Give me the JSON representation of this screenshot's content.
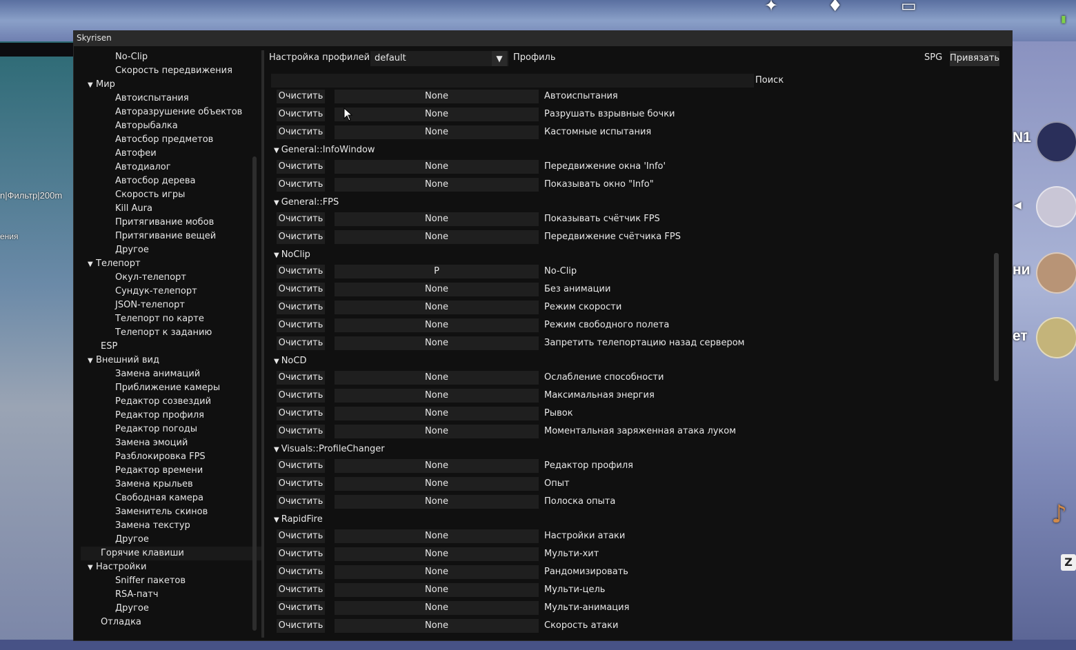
{
  "window": {
    "title": "Skyrisen"
  },
  "background": {
    "left_text_1": "n|Фильтр|200m",
    "left_text_2": "ения",
    "right_labels": [
      "N1",
      "ни",
      "ет"
    ],
    "right_key": "Z"
  },
  "sidebar": {
    "items": [
      {
        "label": "No-Clip",
        "level": 2
      },
      {
        "label": "Скорость передвижения",
        "level": 2
      },
      {
        "label": "Мир",
        "level": 1,
        "expanded": true
      },
      {
        "label": "Автоиспытания",
        "level": 2
      },
      {
        "label": "Авторазрушение объектов",
        "level": 2
      },
      {
        "label": "Авторыбалка",
        "level": 2
      },
      {
        "label": "Автосбор предметов",
        "level": 2
      },
      {
        "label": "Автофеи",
        "level": 2
      },
      {
        "label": "Автодиалог",
        "level": 2
      },
      {
        "label": "Автосбор дерева",
        "level": 2
      },
      {
        "label": "Скорость игры",
        "level": 2
      },
      {
        "label": "Kill Aura",
        "level": 2
      },
      {
        "label": "Притягивание мобов",
        "level": 2
      },
      {
        "label": "Притягивание вещей",
        "level": 2
      },
      {
        "label": "Другое",
        "level": 2
      },
      {
        "label": "Телепорт",
        "level": 1,
        "expanded": true
      },
      {
        "label": "Окул-телепорт",
        "level": 2
      },
      {
        "label": "Сундук-телепорт",
        "level": 2
      },
      {
        "label": "JSON-телепорт",
        "level": 2
      },
      {
        "label": "Телепорт по карте",
        "level": 2
      },
      {
        "label": "Телепорт к заданию",
        "level": 2
      },
      {
        "label": "ESP",
        "level": 1
      },
      {
        "label": "Внешний вид",
        "level": 1,
        "expanded": true
      },
      {
        "label": "Замена анимаций",
        "level": 2
      },
      {
        "label": "Приближение камеры",
        "level": 2
      },
      {
        "label": "Редактор созвездий",
        "level": 2
      },
      {
        "label": "Редактор профиля",
        "level": 2
      },
      {
        "label": "Редактор погоды",
        "level": 2
      },
      {
        "label": "Замена эмоций",
        "level": 2
      },
      {
        "label": "Разблокировка FPS",
        "level": 2
      },
      {
        "label": "Редактор времени",
        "level": 2
      },
      {
        "label": "Замена крыльев",
        "level": 2
      },
      {
        "label": "Свободная камера",
        "level": 2
      },
      {
        "label": "Заменитель скинов",
        "level": 2
      },
      {
        "label": "Замена текстур",
        "level": 2
      },
      {
        "label": "Другое",
        "level": 2
      },
      {
        "label": "Горячие клавиши",
        "level": 1,
        "selected": true
      },
      {
        "label": "Настройки",
        "level": 1,
        "expanded": true
      },
      {
        "label": "Sniffer пакетов",
        "level": 2
      },
      {
        "label": "RSA-патч",
        "level": 2
      },
      {
        "label": "Другое",
        "level": 2
      },
      {
        "label": "Отладка",
        "level": 1
      }
    ]
  },
  "topbar": {
    "profile_settings_label": "Настройка профилей",
    "profile_value": "default",
    "dropdown_arrow": "▼",
    "profile_label": "Профиль",
    "spg_label": "SPG",
    "bind_button": "Привязать"
  },
  "search": {
    "label": "Поиск",
    "value": ""
  },
  "hotkeys": {
    "clear_label": "Очистить",
    "entries": [
      {
        "type": "row",
        "key": "None",
        "name": "Автоиспытания"
      },
      {
        "type": "row",
        "key": "None",
        "name": "Разрушать взрывные бочки"
      },
      {
        "type": "row",
        "key": "None",
        "name": "Кастомные испытания"
      },
      {
        "type": "section",
        "title": "General::InfoWindow"
      },
      {
        "type": "row",
        "key": "None",
        "name": "Передвижение окна 'Info'"
      },
      {
        "type": "row",
        "key": "None",
        "name": "Показывать окно \"Info\""
      },
      {
        "type": "section",
        "title": "General::FPS"
      },
      {
        "type": "row",
        "key": "None",
        "name": "Показывать счётчик FPS"
      },
      {
        "type": "row",
        "key": "None",
        "name": "Передвижение счётчика FPS"
      },
      {
        "type": "section",
        "title": "NoClip"
      },
      {
        "type": "row",
        "key": "P",
        "name": "No-Clip"
      },
      {
        "type": "row",
        "key": "None",
        "name": "Без анимации"
      },
      {
        "type": "row",
        "key": "None",
        "name": "Режим скорости"
      },
      {
        "type": "row",
        "key": "None",
        "name": "Режим свободного полета"
      },
      {
        "type": "row",
        "key": "None",
        "name": "Запретить телепортацию назад сервером"
      },
      {
        "type": "section",
        "title": "NoCD"
      },
      {
        "type": "row",
        "key": "None",
        "name": "Ослабление способности"
      },
      {
        "type": "row",
        "key": "None",
        "name": "Максимальная энергия"
      },
      {
        "type": "row",
        "key": "None",
        "name": "Рывок"
      },
      {
        "type": "row",
        "key": "None",
        "name": "Моментальная заряженная атака луком"
      },
      {
        "type": "section",
        "title": "Visuals::ProfileChanger"
      },
      {
        "type": "row",
        "key": "None",
        "name": "Редактор профиля"
      },
      {
        "type": "row",
        "key": "None",
        "name": "Опыт"
      },
      {
        "type": "row",
        "key": "None",
        "name": "Полоска опыта"
      },
      {
        "type": "section",
        "title": "RapidFire"
      },
      {
        "type": "row",
        "key": "None",
        "name": "Настройки атаки"
      },
      {
        "type": "row",
        "key": "None",
        "name": "Мульти-хит"
      },
      {
        "type": "row",
        "key": "None",
        "name": "Рандомизировать"
      },
      {
        "type": "row",
        "key": "None",
        "name": "Мульти-цель"
      },
      {
        "type": "row",
        "key": "None",
        "name": "Мульти-анимация"
      },
      {
        "type": "row",
        "key": "None",
        "name": "Скорость атаки"
      }
    ]
  }
}
